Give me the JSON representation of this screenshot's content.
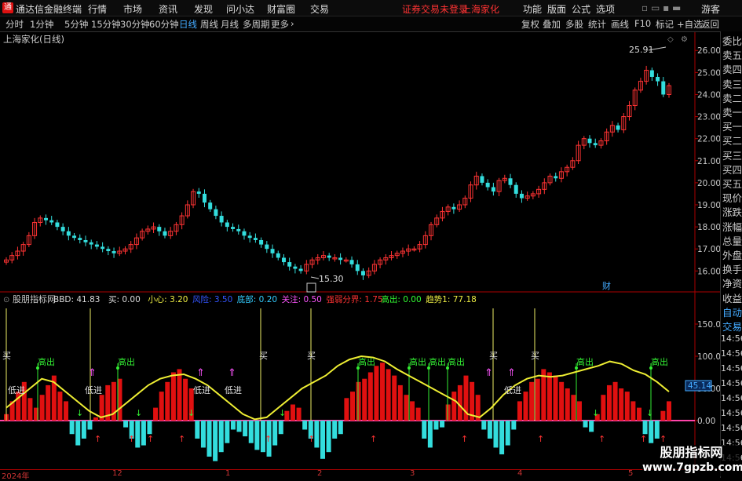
{
  "titlebar": {
    "app_name": "通达信金融终端",
    "menus": [
      "行情",
      "市场",
      "资讯",
      "发现",
      "问小达",
      "财富圈",
      "交易"
    ],
    "status": "证券交易未登录",
    "stock": "上海家化",
    "right_menus": [
      "功能",
      "版面",
      "公式",
      "选项"
    ],
    "guest": "游客"
  },
  "toolbar": {
    "periods": [
      "分时",
      "1分钟",
      "5分钟",
      "15分钟",
      "30分钟",
      "60分钟",
      "日线",
      "周线",
      "月线",
      "多周期",
      "更多"
    ],
    "selected": "日线",
    "tools": [
      "复权",
      "叠加",
      "多股",
      "统计",
      "画线",
      "F10",
      "标记",
      "+自选",
      "返回"
    ]
  },
  "main_chart": {
    "label": "上海家化(日线)",
    "price_high_label": "25.91",
    "price_low_label": "15.30",
    "cai_label": "财",
    "y_ticks": [
      "26.00",
      "25.00",
      "24.00",
      "23.00",
      "22.00",
      "21.00",
      "20.00",
      "19.00",
      "18.00",
      "17.00",
      "16.00"
    ]
  },
  "indicator": {
    "name": "股朋指标网",
    "values": [
      {
        "label": "BBD: 41.83",
        "color": "#dddddd"
      },
      {
        "label": "买: 0.00",
        "color": "#dddddd"
      },
      {
        "label": "小心: 3.20",
        "color": "#eeee44"
      },
      {
        "label": "风险: 3.50",
        "color": "#3355ff"
      },
      {
        "label": "底部: 0.20",
        "color": "#33ccff"
      },
      {
        "label": "关注: 0.50",
        "color": "#ff55ff"
      },
      {
        "label": "强弱分界: 1.75",
        "color": "#ff3333"
      },
      {
        "label": "高出: 0.00",
        "color": "#33ff33"
      },
      {
        "label": "趋势1: 77.18",
        "color": "#eeee44"
      }
    ],
    "y_ticks": [
      "150.0",
      "100.0",
      "50.00",
      "0.00"
    ],
    "current_value": "45.14",
    "signals": {
      "buy": "买",
      "high": "高出",
      "low": "低进"
    }
  },
  "time_axis": [
    "2024年",
    "12",
    "1",
    "2",
    "3",
    "4",
    "5"
  ],
  "right_panel": {
    "items": [
      "委比",
      "卖五",
      "卖四",
      "卖三",
      "卖二",
      "卖一",
      "买一",
      "买二",
      "买三",
      "买四",
      "买五",
      "现价",
      "涨跌",
      "涨幅",
      "总量",
      "外盘",
      "换手",
      "净资",
      "收益",
      "自动",
      "交易"
    ],
    "times": [
      "14:56",
      "14:56",
      "14:56",
      "14:56",
      "14:56",
      "14:56",
      "14:56",
      "14:56",
      "14:56"
    ]
  },
  "watermark": {
    "title": "股朋指标网",
    "url": "www.7gpzb.com"
  },
  "chart_data": {
    "type": "candlestick",
    "closes": [
      16.5,
      16.7,
      16.9,
      17.2,
      17.6,
      18.2,
      18.4,
      18.3,
      18.2,
      18.0,
      17.8,
      17.6,
      17.5,
      17.4,
      17.3,
      17.2,
      17.1,
      17.0,
      16.9,
      16.8,
      16.9,
      17.0,
      17.2,
      17.5,
      17.8,
      17.9,
      18.0,
      17.8,
      17.6,
      17.8,
      18.1,
      18.5,
      19.0,
      19.6,
      19.5,
      19.1,
      18.8,
      18.5,
      18.2,
      18.0,
      17.9,
      17.8,
      17.6,
      17.5,
      17.4,
      17.2,
      17.0,
      16.8,
      16.6,
      16.4,
      16.2,
      16.1,
      16.0,
      16.3,
      16.5,
      16.6,
      16.7,
      16.6,
      16.6,
      16.5,
      16.5,
      16.3,
      16.0,
      15.8,
      16.0,
      16.3,
      16.5,
      16.6,
      16.7,
      16.8,
      16.9,
      17.0,
      17.0,
      17.2,
      17.6,
      18.1,
      18.4,
      18.7,
      18.9,
      18.8,
      19.0,
      19.3,
      19.9,
      20.3,
      20.0,
      19.8,
      19.6,
      20.1,
      20.2,
      19.9,
      19.5,
      19.3,
      19.4,
      19.5,
      19.7,
      20.0,
      20.3,
      20.2,
      20.5,
      20.7,
      21.0,
      21.7,
      22.0,
      21.8,
      21.7,
      21.9,
      22.3,
      22.6,
      22.4,
      23.0,
      23.5,
      24.2,
      24.6,
      25.1,
      24.8,
      24.6,
      24.0,
      24.4
    ],
    "bars": [
      10,
      30,
      45,
      60,
      35,
      20,
      40,
      55,
      70,
      45,
      30,
      -30,
      -55,
      -40,
      -20,
      5,
      40,
      55,
      60,
      65,
      -15,
      -40,
      -60,
      -55,
      -30,
      20,
      45,
      60,
      75,
      80,
      65,
      50,
      -40,
      -60,
      -80,
      -90,
      -70,
      -50,
      -20,
      -25,
      -35,
      -50,
      -65,
      -70,
      -80,
      -55,
      -30,
      15,
      25,
      20,
      -20,
      -40,
      -60,
      -85,
      -70,
      -40,
      -30,
      35,
      45,
      60,
      65,
      75,
      85,
      90,
      80,
      70,
      55,
      40,
      30,
      20,
      -40,
      -60,
      -20,
      -15,
      25,
      45,
      55,
      70,
      60,
      40,
      -20,
      -40,
      -60,
      -75,
      -55,
      -20,
      30,
      45,
      60,
      65,
      80,
      75,
      70,
      60,
      50,
      40,
      30,
      -15,
      -25,
      10,
      40,
      55,
      60,
      50,
      45,
      30,
      20,
      -30,
      -50,
      -40,
      15,
      30
    ],
    "trend": [
      20,
      35,
      50,
      65,
      60,
      45,
      30,
      15,
      5,
      10,
      25,
      40,
      55,
      65,
      70,
      72,
      65,
      55,
      40,
      25,
      10,
      2,
      5,
      20,
      35,
      50,
      60,
      70,
      85,
      95,
      100,
      98,
      92,
      80,
      70,
      60,
      50,
      40,
      30,
      10,
      5,
      20,
      40,
      55,
      65,
      70,
      68,
      70,
      75,
      80,
      85,
      92,
      88,
      78,
      72,
      60,
      45
    ]
  }
}
